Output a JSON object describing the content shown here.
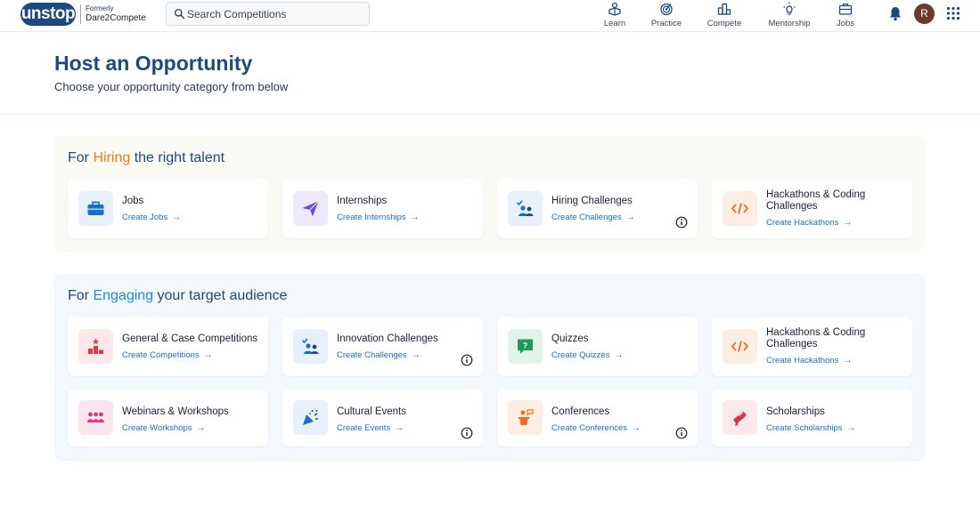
{
  "header": {
    "logo_text": "unstop",
    "formerly_label": "Formerly",
    "formerly_name": "Dare2Compete",
    "search": {
      "placeholder": "Search Competitions"
    },
    "nav": [
      {
        "label": "Learn",
        "icon": "learn-icon"
      },
      {
        "label": "Practice",
        "icon": "practice-icon"
      },
      {
        "label": "Compete",
        "icon": "compete-icon"
      },
      {
        "label": "Mentorship",
        "icon": "mentorship-icon"
      },
      {
        "label": "Jobs",
        "icon": "jobs-icon"
      }
    ],
    "avatar_initial": "R"
  },
  "page": {
    "title": "Host an Opportunity",
    "subtitle": "Choose your opportunity category from below"
  },
  "hiring": {
    "heading_prefix": "For ",
    "heading_highlight": "Hiring",
    "heading_suffix": " the right talent",
    "cards": [
      {
        "title": "Jobs",
        "link": "Create Jobs"
      },
      {
        "title": "Internships",
        "link": "Create Internships"
      },
      {
        "title": "Hiring Challenges",
        "link": "Create Challenges"
      },
      {
        "title": "Hackathons & Coding Challenges",
        "link": "Create Hackathons"
      }
    ]
  },
  "engage": {
    "heading_prefix": "For ",
    "heading_highlight": "Engaging",
    "heading_suffix": " your target audience",
    "cards": [
      {
        "title": "General & Case Competitions",
        "link": "Create Competitions"
      },
      {
        "title": "Innovation Challenges",
        "link": "Create Challenges"
      },
      {
        "title": "Quizzes",
        "link": "Create Quizzes"
      },
      {
        "title": "Hackathons & Coding Challenges",
        "link": "Create Hackathons"
      },
      {
        "title": "Webinars & Workshops",
        "link": "Create Workshops"
      },
      {
        "title": "Cultural Events",
        "link": "Create Events"
      },
      {
        "title": "Conferences",
        "link": "Create Conferences"
      },
      {
        "title": "Scholarships",
        "link": "Create Scholarships"
      }
    ]
  },
  "colors": {
    "brand": "#1c4980",
    "hiring_accent": "#f27b1f",
    "engage_accent": "#1a8ae6",
    "link": "#1a6fc9"
  }
}
